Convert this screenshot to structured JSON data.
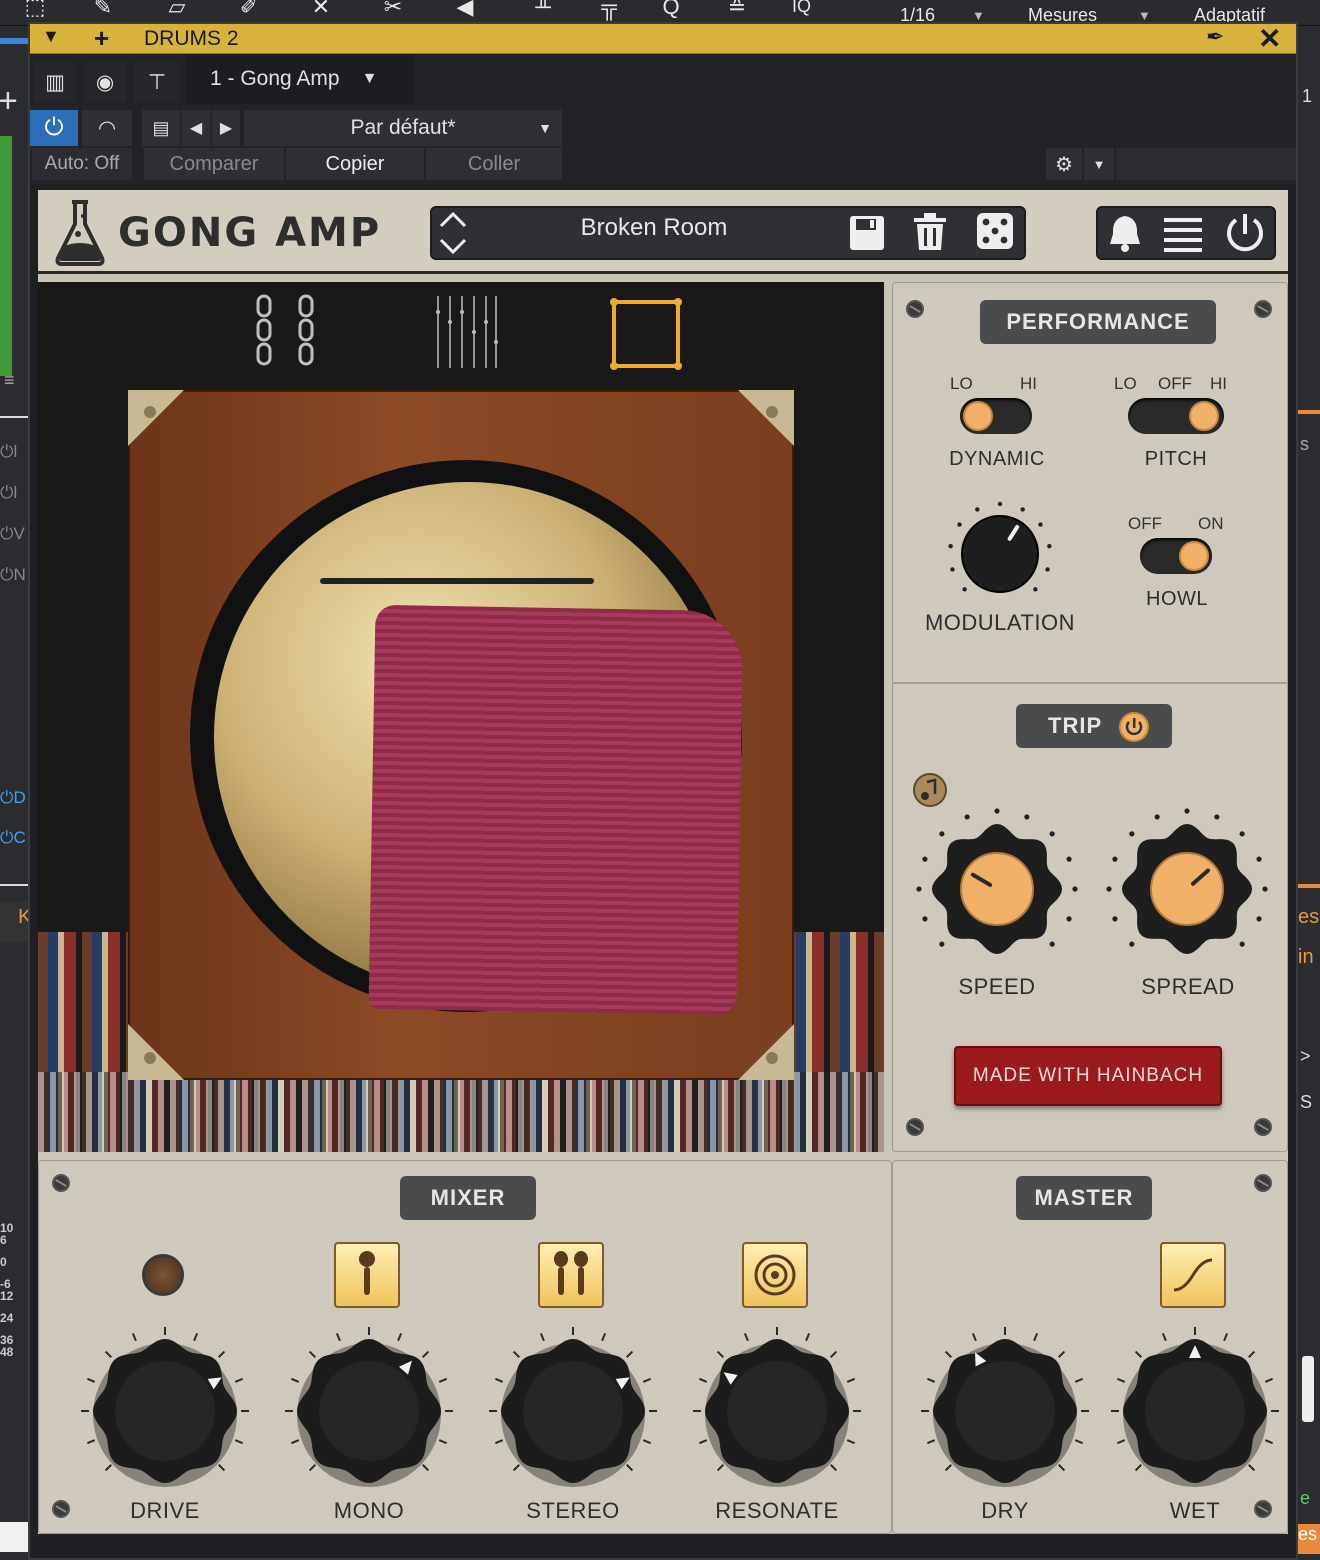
{
  "daw": {
    "grid_value": "1/16",
    "measures_label": "Mesures",
    "adaptive_label": "Adaptatif",
    "iq_label": "IQ",
    "left_track_rows": [
      "l",
      "l",
      "V",
      "N",
      "D",
      "C",
      "K"
    ],
    "meter_scale": [
      "10",
      "6",
      "0",
      "-6",
      "12",
      "24",
      "36",
      "48"
    ],
    "right_letters": [
      "1",
      "s",
      "es",
      "in",
      ">",
      "S",
      "e",
      "es"
    ]
  },
  "window": {
    "title": "DRUMS 2",
    "plugin_slot": "1 - Gong Amp",
    "preset": "Par défaut*",
    "auto_label": "Auto: Off",
    "compare_label": "Comparer",
    "copy_label": "Copier",
    "paste_label": "Coller"
  },
  "plugin": {
    "brand": "GONG AMP",
    "preset_name": "Broken Room",
    "performance": {
      "title": "PERFORMANCE",
      "dynamic": {
        "label": "DYNAMIC",
        "lo": "LO",
        "hi": "HI",
        "state": "LO"
      },
      "pitch": {
        "label": "PITCH",
        "lo": "LO",
        "off": "OFF",
        "hi": "HI",
        "state": "HI"
      },
      "modulation": {
        "label": "MODULATION",
        "value": 0.62
      },
      "howl": {
        "label": "HOWL",
        "off": "OFF",
        "on": "ON",
        "state": "ON"
      }
    },
    "trip": {
      "title": "TRIP",
      "speed": {
        "label": "SPEED",
        "value": 0.28
      },
      "spread": {
        "label": "SPREAD",
        "value": 0.68
      }
    },
    "badge": "MADE WITH HAINBACH",
    "mixer": {
      "title": "MIXER",
      "channels": [
        {
          "label": "DRIVE",
          "value": 0.72
        },
        {
          "label": "MONO",
          "value": 0.65
        },
        {
          "label": "STEREO",
          "value": 0.72
        },
        {
          "label": "RESONATE",
          "value": 0.3
        }
      ]
    },
    "master": {
      "title": "MASTER",
      "dry": {
        "label": "DRY",
        "value": 0.4
      },
      "wet": {
        "label": "WET",
        "value": 0.5
      }
    },
    "colors": {
      "accent": "#f0b067",
      "panel": "#cfc9bd",
      "badge": "#9b1b1c",
      "title_bar": "#d8b33c"
    }
  }
}
